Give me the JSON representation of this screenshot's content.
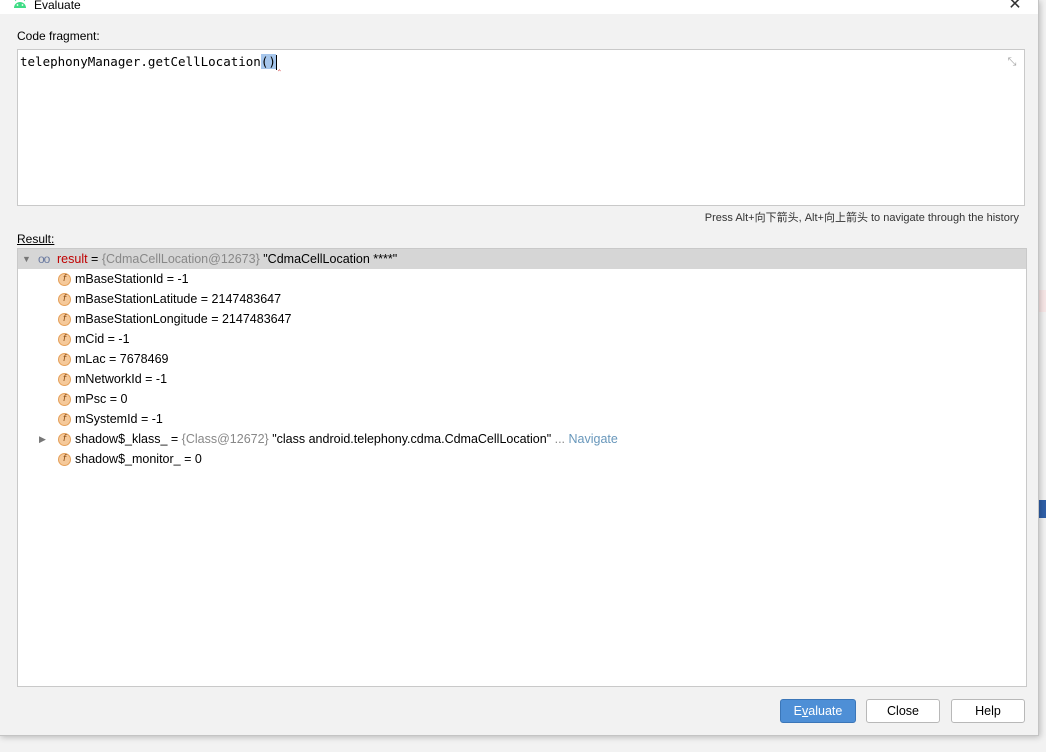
{
  "window": {
    "title": "Evaluate",
    "close_glyph": "✕"
  },
  "code": {
    "label": "Code fragment:",
    "value_prefix": "telephonyManager.getCellLocation",
    "value_parens": "()",
    "collapse_glyph": "⤡"
  },
  "hint": "Press Alt+向下箭头, Alt+向上箭头 to navigate through the history",
  "result": {
    "label": "Result:",
    "root": {
      "name": "result",
      "eq": " = ",
      "ref": "{CdmaCellLocation@12673}",
      "value": " \"CdmaCellLocation ****\""
    },
    "fields": [
      {
        "text": "mBaseStationId = -1"
      },
      {
        "text": "mBaseStationLatitude = 2147483647"
      },
      {
        "text": "mBaseStationLongitude = 2147483647"
      },
      {
        "text": "mCid = -1"
      },
      {
        "text": "mLac = 7678469"
      },
      {
        "text": "mNetworkId = -1"
      },
      {
        "text": "mPsc = 0"
      },
      {
        "text": "mSystemId = -1"
      }
    ],
    "klass": {
      "name": "shadow$_klass_ = ",
      "ref": "{Class@12672}",
      "value": " \"class android.telephony.cdma.CdmaCellLocation\"",
      "ellipsis": " ... ",
      "navigate": "Navigate"
    },
    "monitor": {
      "text": "shadow$_monitor_ = 0"
    }
  },
  "buttons": {
    "evaluate_first": "E",
    "evaluate_underlined": "v",
    "evaluate_rest": "aluate",
    "close": "Close",
    "help": "Help"
  },
  "colors": {
    "primary_button": "#4e8fd6",
    "field_icon": "#f5c99a",
    "link": "#6897bb"
  },
  "icons": [
    "android-icon",
    "close-icon",
    "collapse-icon",
    "expand-triangle-icon",
    "watch-glasses-icon",
    "field-icon"
  ]
}
